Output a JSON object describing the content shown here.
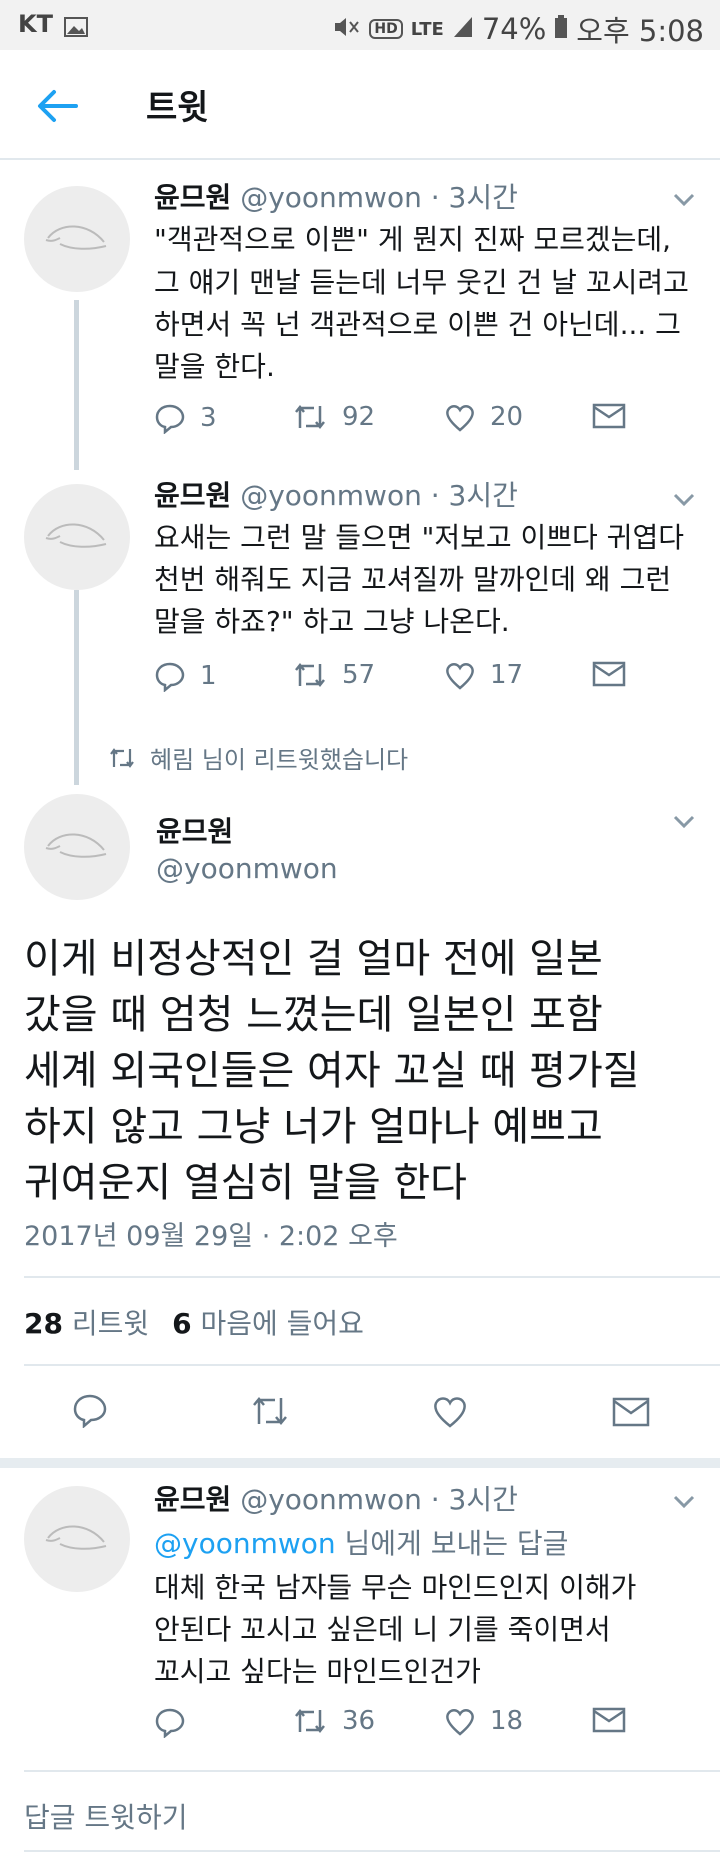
{
  "status_bar": {
    "carrier": "KT",
    "battery": "74%",
    "time": "오후 5:08",
    "network": "LTE"
  },
  "header": {
    "title": "트윗"
  },
  "tweets": [
    {
      "user": "윤므원",
      "handle": "@yoonmwon",
      "time": "3시간",
      "lines": [
        "\"객관적으로 이쁜\" 게 뭔지 진짜 모르겠는데,",
        "그 얘기 맨날 듣는데 너무 웃긴 건 날 꼬시려고",
        "하면서 꼭 넌 객관적으로 이쁜 건 아닌데... 그",
        "말을 한다."
      ],
      "replies": "3",
      "retweets": "92",
      "likes": "20"
    },
    {
      "user": "윤므원",
      "handle": "@yoonmwon",
      "time": "3시간",
      "lines": [
        "요새는 그런 말 들으면 \"저보고 이쁘다 귀엽다",
        "천번 해줘도 지금 꼬셔질까 말까인데 왜 그런",
        "말을 하죠?\" 하고 그냥 나온다."
      ],
      "replies": "1",
      "retweets": "57",
      "likes": "17"
    }
  ],
  "retweet_notice": "혜림 님이 리트윗했습니다",
  "main_tweet": {
    "user": "윤므원",
    "handle": "@yoonmwon",
    "lines": [
      "이게 비정상적인 걸 얼마 전에 일본",
      "갔을 때 엄청 느꼈는데 일본인 포함",
      "세계 외국인들은 여자 꼬실 때 평가질",
      "하지 않고 그냥 너가 얼마나 예쁘고",
      "귀여운지 열심히 말을 한다"
    ],
    "timestamp": "2017년 09월 29일 · 2:02 오후",
    "retweet_count": "28",
    "retweet_label": "리트윗",
    "like_count": "6",
    "like_label": "마음에 들어요"
  },
  "reply_tweet": {
    "user": "윤므원",
    "handle": "@yoonmwon",
    "time": "3시간",
    "reply_to": "@yoonmwon",
    "reply_to_suffix": "님에게 보내는 답글",
    "lines": [
      "대체 한국 남자들 무슨 마인드인지 이해가",
      "안된다 꼬시고 싶은데 니 기를 죽이면서",
      "꼬시고 싶다는 마인드인건가"
    ],
    "retweets": "36",
    "likes": "18"
  },
  "compose_placeholder": "답글 트윗하기",
  "colors": {
    "accent": "#1da1f2",
    "secondary_text": "#657786",
    "divider": "#e1e8ed"
  }
}
